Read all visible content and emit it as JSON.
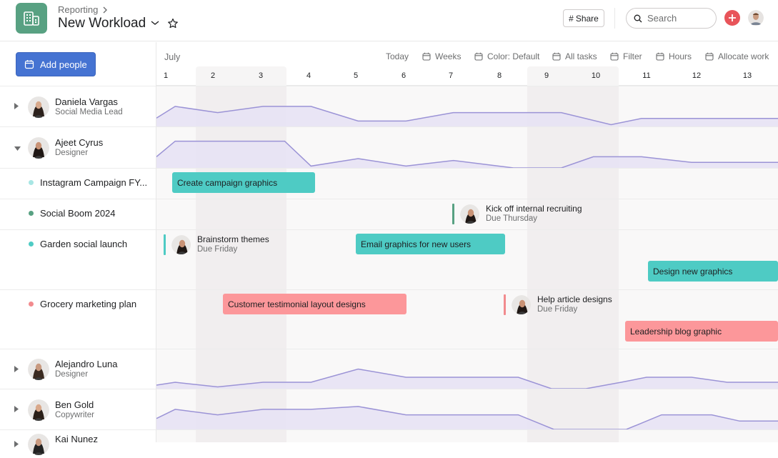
{
  "header": {
    "breadcrumb": "Reporting",
    "breadcrumb_chevron": "chevron-right-icon",
    "title": "New Workload",
    "share_label": "Share",
    "search_placeholder": "Search",
    "app_icon": "building-icon"
  },
  "colors": {
    "brand_green": "#58a182",
    "primary_blue": "#4573d2",
    "add_red": "#e8545a",
    "workload_line": "#9b93d6",
    "workload_fill": "#e6e2f4",
    "teal_task": "#4ecbc4",
    "coral_task": "#fc979a",
    "milestone_green": "#58a182"
  },
  "sidebar": {
    "add_people_label": "Add people"
  },
  "toolbar": {
    "month": "July",
    "items": [
      {
        "label": "Today",
        "icon": null
      },
      {
        "label": "Weeks",
        "icon": "calendar-icon"
      },
      {
        "label": "Color: Default",
        "icon": "calendar-icon"
      },
      {
        "label": "All tasks",
        "icon": "calendar-icon"
      },
      {
        "label": "Filter",
        "icon": "calendar-icon"
      },
      {
        "label": "Hours",
        "icon": "calendar-icon"
      },
      {
        "label": "Allocate work",
        "icon": "calendar-icon"
      }
    ]
  },
  "days": [
    "1",
    "2",
    "3",
    "4",
    "5",
    "6",
    "7",
    "8",
    "9",
    "10",
    "11",
    "12",
    "13"
  ],
  "people": [
    {
      "name": "Daniela Vargas",
      "role": "Social Media Lead",
      "expanded": false,
      "workload": [
        [
          0,
          0.23
        ],
        [
          0.2,
          0.55
        ],
        [
          1.1,
          0.38
        ],
        [
          2.05,
          0.55
        ],
        [
          3.05,
          0.55
        ],
        [
          4.05,
          0.15
        ],
        [
          5.05,
          0.15
        ],
        [
          6.05,
          0.38
        ],
        [
          8.3,
          0.38
        ],
        [
          9.3,
          0.05
        ],
        [
          9.9,
          0.22
        ],
        [
          10.9,
          0.22
        ]
      ]
    },
    {
      "name": "Ajeet Cyrus",
      "role": "Designer",
      "expanded": true,
      "workload": [
        [
          0,
          0.3
        ],
        [
          0.2,
          0.72
        ],
        [
          2.5,
          0.72
        ],
        [
          3.05,
          0.05
        ],
        [
          4.05,
          0.25
        ],
        [
          5.05,
          0.05
        ],
        [
          6.05,
          0.2
        ],
        [
          7.3,
          0.0
        ],
        [
          8.3,
          0.0
        ],
        [
          8.95,
          0.3
        ],
        [
          9.9,
          0.3
        ],
        [
          10.9,
          0.15
        ]
      ]
    },
    {
      "name": "Alejandro Luna",
      "role": "Designer",
      "expanded": false,
      "workload": [
        [
          0,
          0.1
        ],
        [
          0.2,
          0.18
        ],
        [
          1.1,
          0.05
        ],
        [
          2.05,
          0.18
        ],
        [
          3.05,
          0.18
        ],
        [
          4.05,
          0.55
        ],
        [
          5.05,
          0.32
        ],
        [
          6.05,
          0.32
        ],
        [
          7.4,
          0.32
        ],
        [
          8.1,
          0.0
        ],
        [
          8.8,
          0.0
        ],
        [
          9.5,
          0.18
        ],
        [
          10.0,
          0.32
        ],
        [
          10.9,
          0.32
        ],
        [
          11.6,
          0.18
        ],
        [
          12.6,
          0.18
        ]
      ]
    },
    {
      "name": "Ben Gold",
      "role": "Copywriter",
      "expanded": false,
      "workload": [
        [
          0,
          0.3
        ],
        [
          0.2,
          0.55
        ],
        [
          1.1,
          0.4
        ],
        [
          2.05,
          0.55
        ],
        [
          3.05,
          0.55
        ],
        [
          4.05,
          0.63
        ],
        [
          5.05,
          0.4
        ],
        [
          6.05,
          0.4
        ],
        [
          7.4,
          0.4
        ],
        [
          8.15,
          0.0
        ],
        [
          9.6,
          0.0
        ],
        [
          10.3,
          0.4
        ],
        [
          11.3,
          0.4
        ],
        [
          11.85,
          0.23
        ],
        [
          12.6,
          0.23
        ]
      ]
    },
    {
      "name": "Kai Nunez",
      "role": "",
      "expanded": false,
      "workload": []
    }
  ],
  "projects": [
    {
      "name": "Instagram Campaign FY...",
      "dot": "#a8e6e4",
      "items": [
        {
          "type": "bar",
          "label": "Create campaign graphics",
          "color": "teal",
          "lane": 0
        }
      ]
    },
    {
      "name": "Social Boom 2024",
      "dot": "#58a182",
      "items": [
        {
          "type": "milestone",
          "label": "Kick off internal recruiting",
          "due": "Due Thursday",
          "color": "#58a182",
          "lane": 0
        }
      ]
    },
    {
      "name": "Garden social launch",
      "dot": "#4ecbc4",
      "items": [
        {
          "type": "milestone",
          "label": "Brainstorm themes",
          "due": "Due Friday",
          "color": "#4ecbc4",
          "lane": 0
        },
        {
          "type": "bar",
          "label": "Email graphics for new users",
          "color": "teal",
          "lane": 0
        },
        {
          "type": "bar",
          "label": "Design new graphics",
          "color": "teal",
          "lane": 1
        }
      ]
    },
    {
      "name": "Grocery marketing plan",
      "dot": "#f28b8e",
      "items": [
        {
          "type": "bar",
          "label": "Customer testimonial layout designs",
          "color": "coral",
          "lane": 0
        },
        {
          "type": "milestone",
          "label": "Help article designs",
          "due": "Due Friday",
          "color": "#f28b8e",
          "lane": 0
        },
        {
          "type": "bar",
          "label": "Leadership blog graphic",
          "color": "coral",
          "lane": 1
        }
      ]
    }
  ]
}
